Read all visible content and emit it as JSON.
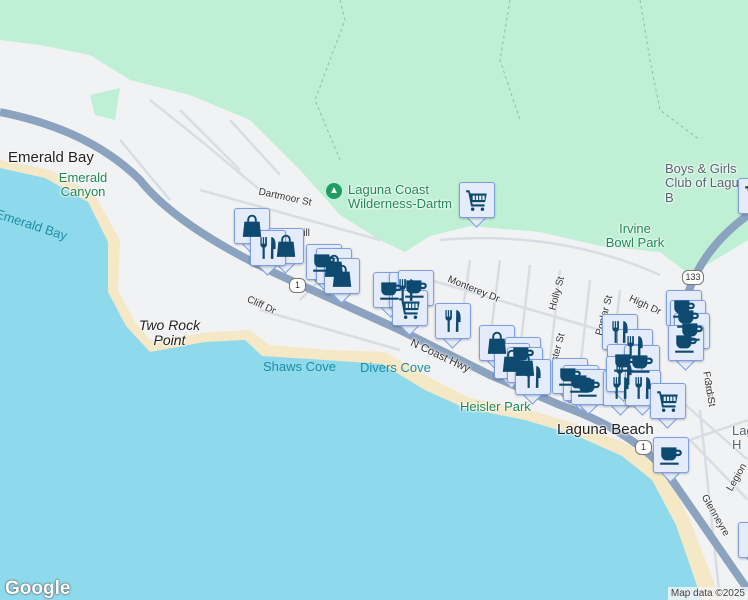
{
  "places": {
    "emerald_bay": "Emerald Bay",
    "emerald_canyon": "Emerald Canyon",
    "emerald_bay_water": "Emerald Bay",
    "two_rock_point": "Two Rock Point",
    "shaws_cove": "Shaws Cove",
    "divers_cove": "Divers Cove",
    "heisler_park": "Heisler Park",
    "laguna_beach": "Laguna Beach",
    "laguna_coast": "Laguna Coast Wilderness-Dartm",
    "irvine_bowl": "Irvine Bowl Park",
    "boys_girls": "Boys & Girls Club of Laguna B",
    "laguna_h": "Lag H"
  },
  "streets": {
    "dartmoor": "Dartmoor St",
    "cliff": "Cliff Dr",
    "monterey": "Monterey Dr",
    "holly": "Holly St",
    "poplar": "Poplar St",
    "high": "High Dr",
    "coast_hwy": "N Coast Hwy",
    "forest": "Forest",
    "third": "3rd St",
    "glenneyre": "Glenneyre",
    "legion": "Legion",
    "aster": "ster St",
    "hill": "Hill"
  },
  "route_shields": {
    "r1": "1",
    "r133": "133"
  },
  "icons": {
    "cart": "shopping-cart-icon",
    "restaurant": "restaurant-icon",
    "shop": "shopping-bag-icon",
    "coffee": "coffee-icon",
    "park": "park-tree-icon"
  },
  "colors": {
    "water": "#8fd9ec",
    "park": "#bff0d5",
    "land": "#f1f2f4",
    "highway": "#8ba3bf",
    "marker": "#e4ecfb",
    "marker_icon": "#0e4a6f"
  },
  "footer": {
    "logo": "Google",
    "attribution": "Map data ©2025"
  }
}
